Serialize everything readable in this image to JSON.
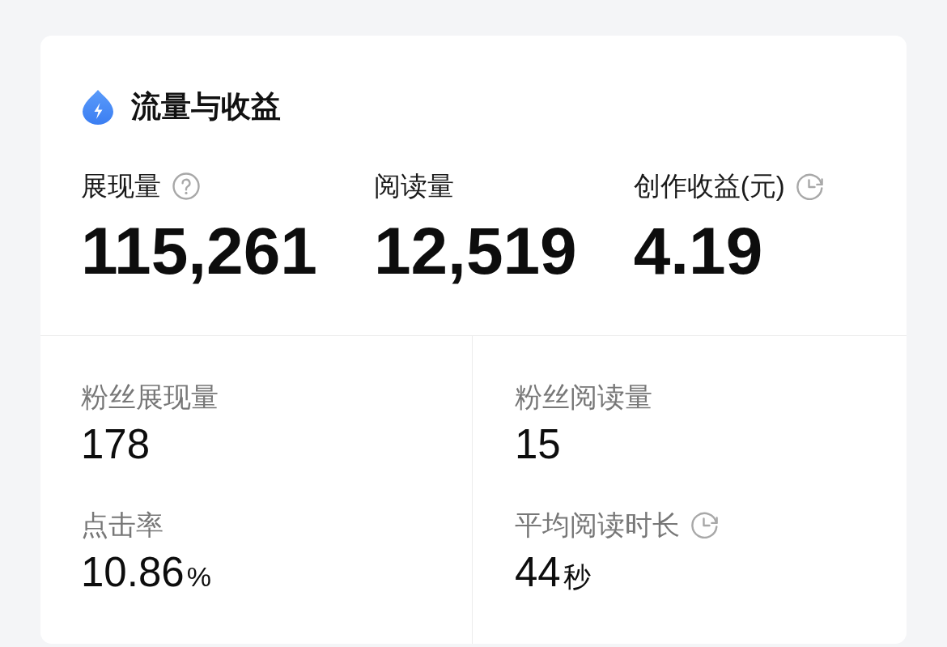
{
  "card": {
    "title": "流量与收益",
    "metrics": [
      {
        "label": "展现量",
        "value": "115,261",
        "kind": "help"
      },
      {
        "label": "阅读量",
        "value": "12,519",
        "kind": "plain"
      },
      {
        "label": "创作收益(元)",
        "value": "4.19",
        "kind": "delayed"
      }
    ],
    "details": [
      {
        "label": "粉丝展现量",
        "value": "178",
        "kind": "plain"
      },
      {
        "label": "粉丝阅读量",
        "value": "15",
        "kind": "plain"
      },
      {
        "label": "点击率",
        "value": "10.86",
        "unit": "%",
        "kind": "plain"
      },
      {
        "label": "平均阅读时长",
        "value": "44",
        "unit": "秒",
        "kind": "delayed"
      }
    ]
  }
}
